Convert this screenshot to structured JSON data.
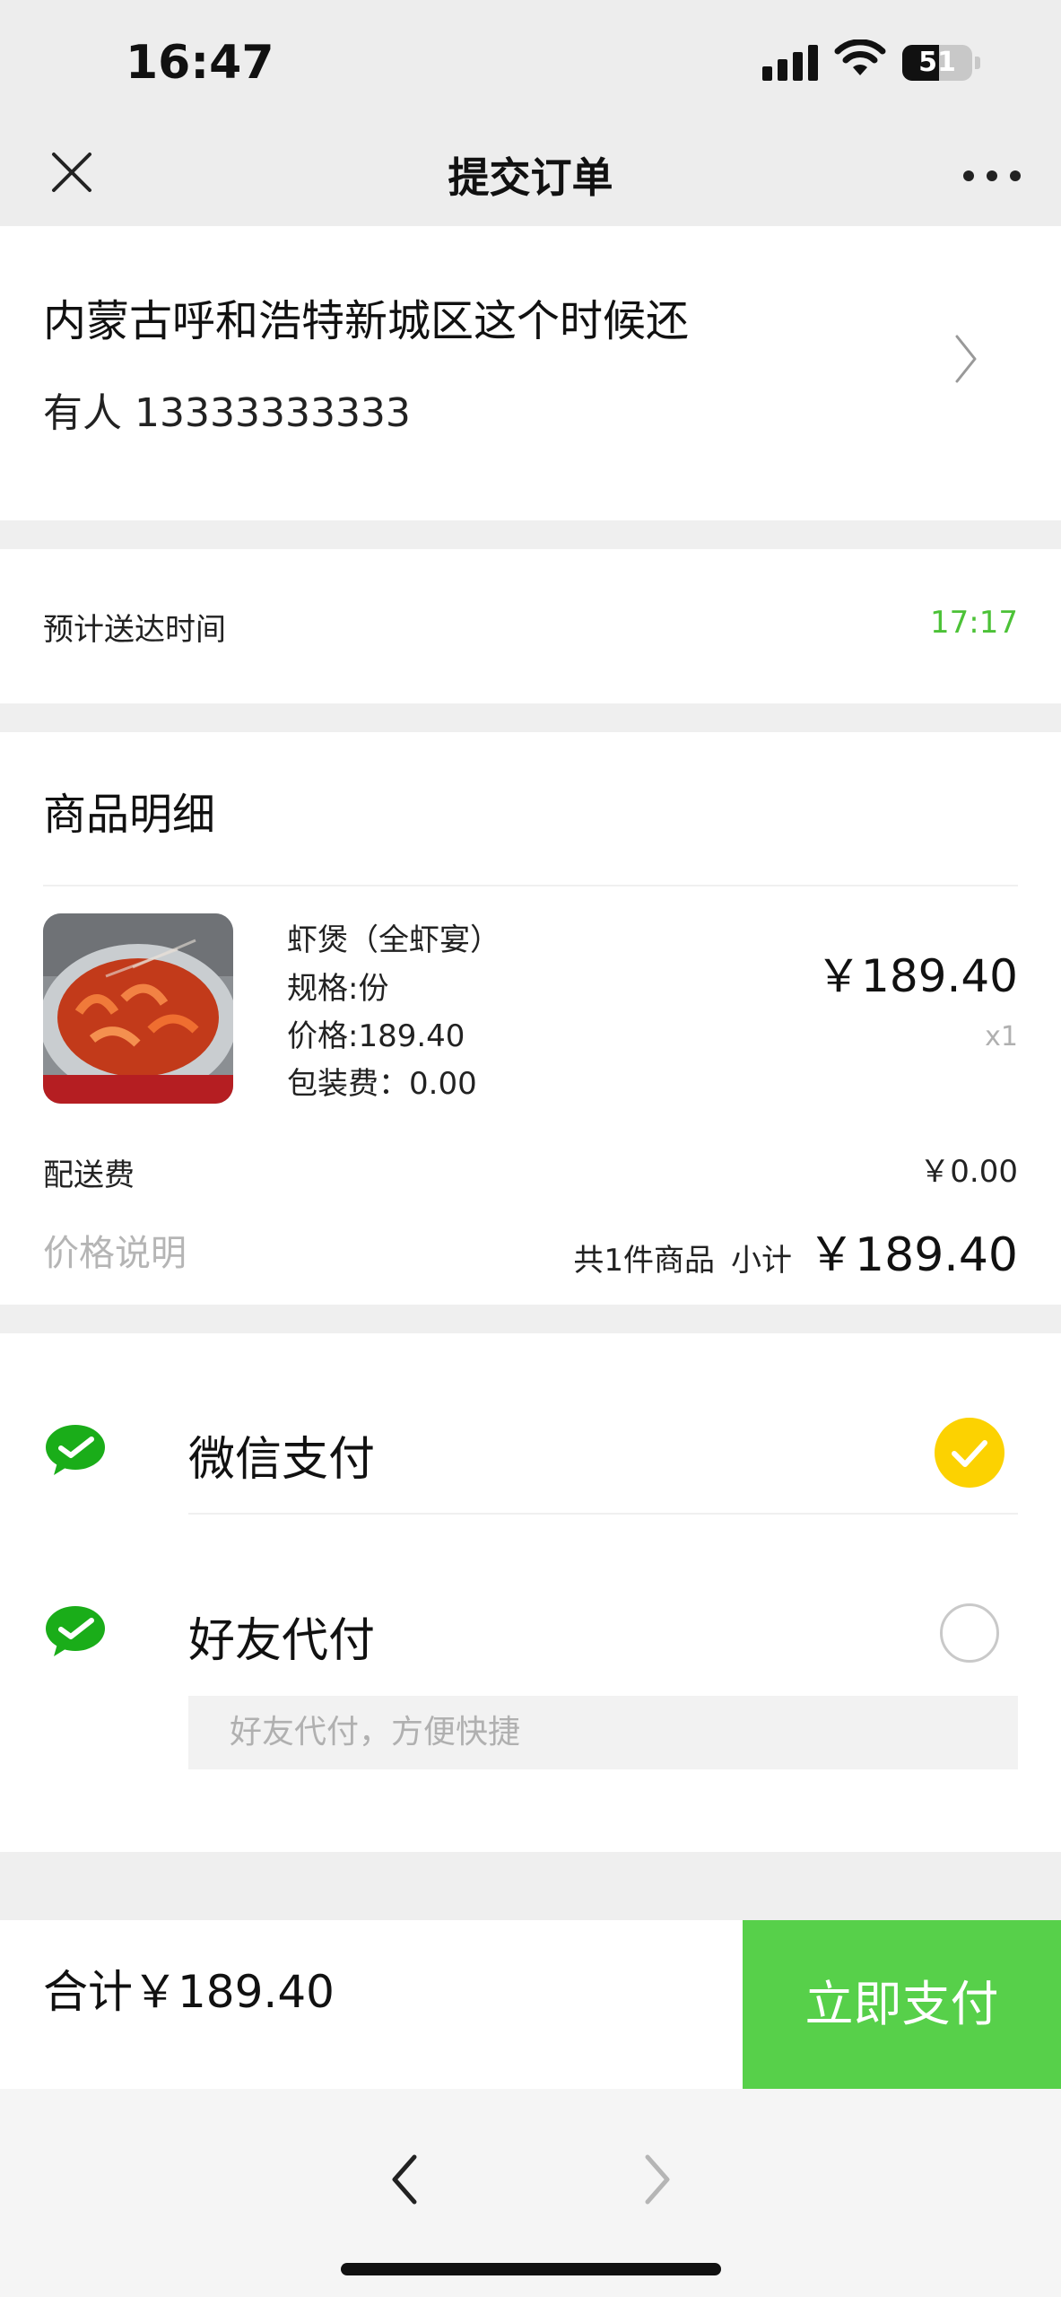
{
  "status_bar": {
    "time": "16:47",
    "battery": "51"
  },
  "nav": {
    "title": "提交订单"
  },
  "address": {
    "line": "内蒙古呼和浩特新城区这个时候还",
    "contact": "有人 13333333333"
  },
  "delivery": {
    "label": "预计送达时间",
    "time": "17:17"
  },
  "items": {
    "title": "商品明细",
    "list": [
      {
        "name": "虾煲（全虾宴）",
        "spec": "规格:份",
        "price_line": "价格:189.40",
        "packaging": "包装费：0.00",
        "price": "￥189.40",
        "qty": "x1"
      }
    ],
    "delivery_fee_label": "配送费",
    "delivery_fee": "￥0.00",
    "price_note": "价格说明",
    "count_text": "共1件商品",
    "subtotal_label": "小计",
    "subtotal": "￥189.40"
  },
  "payment": {
    "options": [
      {
        "label": "微信支付",
        "selected": true
      },
      {
        "label": "好友代付",
        "selected": false
      }
    ],
    "friend_placeholder": "好友代付，方便快捷"
  },
  "footer": {
    "total": "合计￥189.40",
    "pay_button": "立即支付"
  },
  "colors": {
    "accent_green": "#57d04a",
    "eta_green": "#4cc237",
    "check_yellow": "#fcd201",
    "wechat_green": "#1aad19"
  },
  "icons": [
    "close-icon",
    "more-icon",
    "chevron-right-icon",
    "wechat-pay-icon",
    "check-icon",
    "back-arrow-icon",
    "forward-arrow-icon"
  ]
}
